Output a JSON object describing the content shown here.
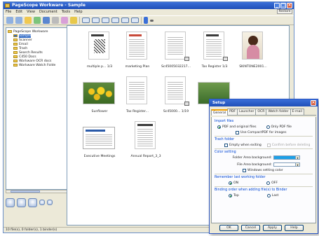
{
  "window": {
    "title": "PageScope Workware - Sample",
    "menu": [
      "File",
      "Edit",
      "View",
      "Document",
      "Tools",
      "Help"
    ],
    "restore_label": "Restore",
    "status": "10 file(s), 0 folder(s), 1 binder(s)"
  },
  "tree": {
    "root": "PageScope Workware",
    "items": [
      {
        "label": "Sample",
        "selected": true
      },
      {
        "label": "Scanner"
      },
      {
        "label": "Email"
      },
      {
        "label": "Trash"
      },
      {
        "label": "Search Results"
      },
      {
        "label": "C450 Docs"
      },
      {
        "label": "Workware OCR docs"
      },
      {
        "label": "Workware Watch Folde"
      }
    ]
  },
  "files": [
    {
      "caption": "multiple p...  1/3"
    },
    {
      "caption": "marketing Plan"
    },
    {
      "caption": "Sc45005032217..."
    },
    {
      "caption": "Tax Register  1/3"
    },
    {
      "caption": "SKINTONE2001..."
    },
    {
      "caption": "Sunflower"
    },
    {
      "caption": "Tax Register..."
    },
    {
      "caption": "Sc45000...  1/19"
    },
    {
      "caption": ""
    },
    {
      "caption": "Executive Meetings"
    },
    {
      "caption": "Annual Report_3_3"
    }
  ],
  "dialog": {
    "title": "Setup",
    "tabs": [
      "General",
      "PDF",
      "Launcher",
      "OCR",
      "Watch folder",
      "E-mail"
    ],
    "import_files": {
      "title": "Import files",
      "pdf_and_original": "PDF and original files",
      "only_pdf": "Only PDF file",
      "use_compact": "Use CompactPDF for images"
    },
    "trash_folder": {
      "title": "Trash folder",
      "empty_when_exiting": "Empty when exiting",
      "confirm_before": "Confirm before deleting"
    },
    "color_setting": {
      "title": "Color setting",
      "folder_bg": "Folder Area background:",
      "file_bg": "File Area background:",
      "windows_color": "Windows setting color"
    },
    "remember": {
      "title": "Remember last working folder",
      "on": "ON",
      "off": "OFF"
    },
    "binding": {
      "title": "Binding order when adding file(s) to Binder",
      "top": "Top",
      "last": "Last"
    },
    "buttons": {
      "ok": "OK",
      "cancel": "Cancel",
      "apply": "Apply",
      "help": "Help"
    }
  },
  "colors": {
    "folder_area": "#1ca0e8",
    "file_area": "#ffffff",
    "accent": "#316ac5"
  }
}
